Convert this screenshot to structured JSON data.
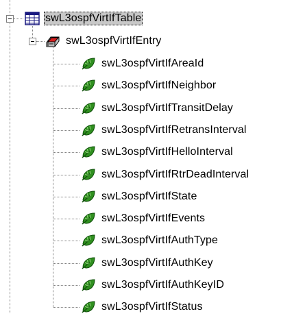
{
  "tree": {
    "root": {
      "label": "swL3ospfVirtIfTable",
      "icon": "table-icon",
      "expanded": true,
      "selected": true
    },
    "entry": {
      "label": "swL3ospfVirtIfEntry",
      "icon": "entry-icon",
      "expanded": true
    },
    "leaves": [
      {
        "label": "swL3ospfVirtIfAreaId",
        "icon": "leaf-icon"
      },
      {
        "label": "swL3ospfVirtIfNeighbor",
        "icon": "leaf-icon"
      },
      {
        "label": "swL3ospfVirtIfTransitDelay",
        "icon": "leaf-icon"
      },
      {
        "label": "swL3ospfVirtIfRetransInterval",
        "icon": "leaf-icon"
      },
      {
        "label": "swL3ospfVirtIfHelloInterval",
        "icon": "leaf-icon"
      },
      {
        "label": "swL3ospfVirtIfRtrDeadInterval",
        "icon": "leaf-icon"
      },
      {
        "label": "swL3ospfVirtIfState",
        "icon": "leaf-icon"
      },
      {
        "label": "swL3ospfVirtIfEvents",
        "icon": "leaf-icon"
      },
      {
        "label": "swL3ospfVirtIfAuthType",
        "icon": "leaf-icon"
      },
      {
        "label": "swL3ospfVirtIfAuthKey",
        "icon": "leaf-icon"
      },
      {
        "label": "swL3ospfVirtIfAuthKeyID",
        "icon": "leaf-icon"
      },
      {
        "label": "swL3ospfVirtIfStatus",
        "icon": "leaf-icon"
      }
    ]
  },
  "colors": {
    "selection": "#c8c8c8",
    "connector": "#808080",
    "leaf_green": "#2f8f1f"
  }
}
